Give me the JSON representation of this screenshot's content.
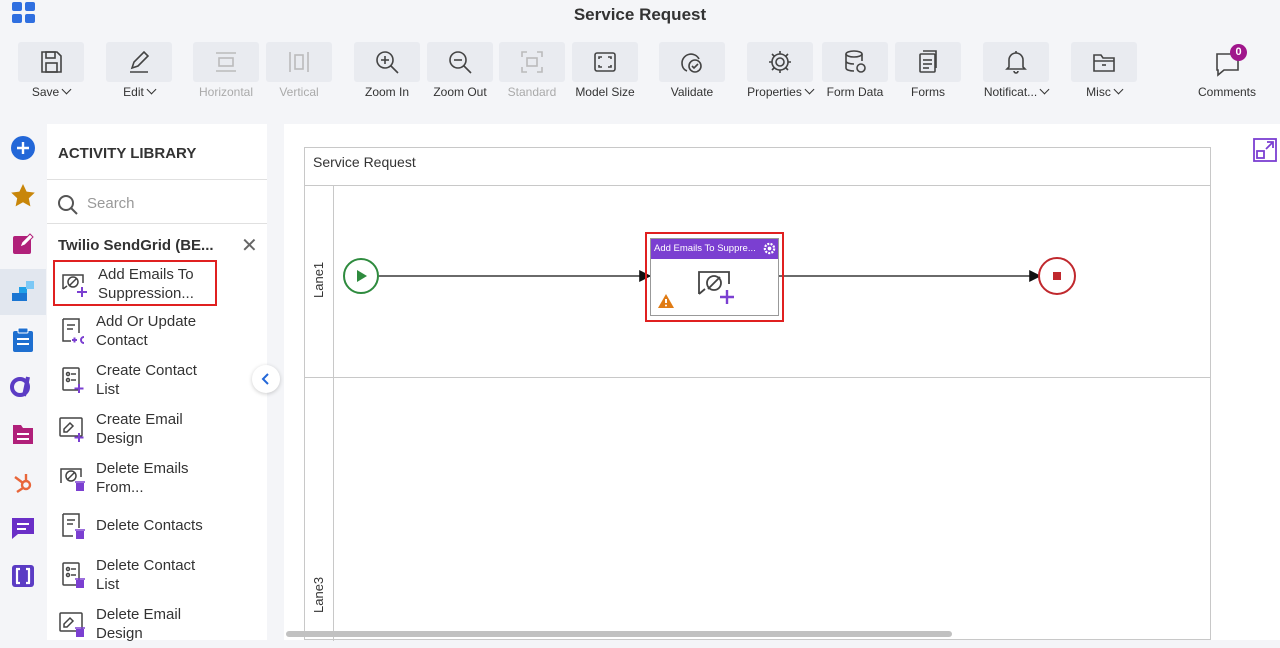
{
  "app": {
    "title": "Service Request"
  },
  "toolbar": {
    "save": "Save",
    "edit": "Edit",
    "horizontal": "Horizontal",
    "vertical": "Vertical",
    "zoom_in": "Zoom In",
    "zoom_out": "Zoom Out",
    "standard": "Standard",
    "model_size": "Model Size",
    "validate": "Validate",
    "properties": "Properties",
    "form_data": "Form Data",
    "forms": "Forms",
    "notifications": "Notificat...",
    "misc": "Misc",
    "comments": "Comments",
    "comments_count": "0"
  },
  "library": {
    "title": "ACTIVITY LIBRARY",
    "search_placeholder": "Search",
    "category": "Twilio SendGrid (BE...",
    "close_symbol": "✕",
    "items": [
      {
        "label": "Add Emails To Suppression...",
        "icon": "suppression-add-icon"
      },
      {
        "label": "Add Or Update Contact",
        "icon": "contact-update-icon"
      },
      {
        "label": "Create Contact List",
        "icon": "contact-list-add-icon"
      },
      {
        "label": "Create Email Design",
        "icon": "email-design-add-icon"
      },
      {
        "label": "Delete Emails From...",
        "icon": "suppression-delete-icon"
      },
      {
        "label": "Delete Contacts",
        "icon": "contact-delete-icon"
      },
      {
        "label": "Delete Contact List",
        "icon": "contact-list-delete-icon"
      },
      {
        "label": "Delete Email Design",
        "icon": "email-design-delete-icon"
      }
    ]
  },
  "canvas": {
    "pool_title": "Service Request",
    "lanes": [
      "Lane1",
      "Lane3"
    ],
    "task_title": "Add Emails To Suppre...",
    "task_icon": "suppression-add-icon"
  },
  "colors": {
    "accent_purple": "#7b3fd1",
    "start_green": "#2e8b3e",
    "end_red": "#c0282d",
    "selection_red": "#e02020"
  }
}
